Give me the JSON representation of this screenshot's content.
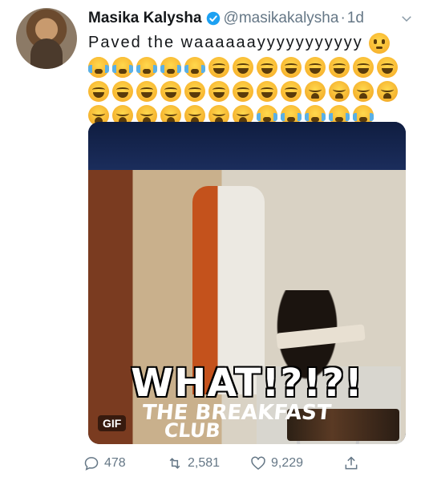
{
  "tweet": {
    "author_name": "Masika Kalysha",
    "handle": "@masikakalysha",
    "separator": "·",
    "time": "1d",
    "text": "Paved the waaaaaayyyyyyyyyyy",
    "emojis": [
      [
        "flushed",
        "joy",
        "sob"
      ],
      [
        "sob",
        "sob",
        "sob",
        "sob",
        "sob",
        "joy",
        "joy",
        "joy",
        "joy",
        "joy",
        "joy",
        "joy",
        "joy"
      ],
      [
        "joy",
        "joy",
        "joy",
        "joy",
        "joy",
        "joy",
        "joy",
        "joy",
        "joy",
        "weary",
        "weary",
        "weary",
        "weary"
      ],
      [
        "weary",
        "weary",
        "weary",
        "weary",
        "weary",
        "weary",
        "weary",
        "sob",
        "sob",
        "sob",
        "sob",
        "sob"
      ]
    ]
  },
  "media": {
    "caption_text": "WHAT!?!?!",
    "badge": "GIF",
    "logo_line1": "THE BREAKFAST",
    "logo_line2": "CLUB"
  },
  "actions": {
    "replies": "478",
    "retweets": "2,581",
    "likes": "9,229"
  },
  "colors": {
    "verified": "#1da1f2",
    "muted": "#657786",
    "text": "#14171a"
  },
  "icons": {
    "verified": "verified-badge-icon",
    "caret": "chevron-down-icon",
    "reply": "reply-icon",
    "retweet": "retweet-icon",
    "like": "heart-icon",
    "share": "share-icon"
  }
}
